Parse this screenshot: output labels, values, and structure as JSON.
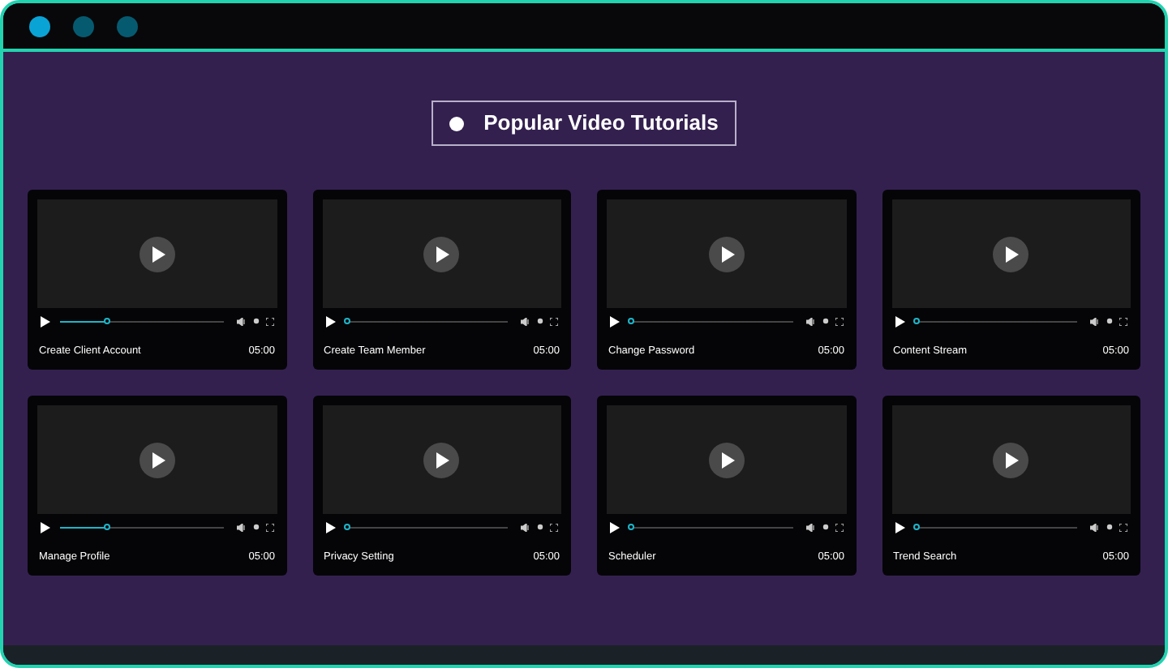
{
  "heading": "Popular Video Tutorials",
  "videos": [
    {
      "title": "Create Client Account",
      "duration": "05:00",
      "level": 0.29
    },
    {
      "title": "Create Team Member",
      "duration": "05:00",
      "level": 0.01
    },
    {
      "title": "Change Password",
      "duration": "05:00",
      "level": 0.01
    },
    {
      "title": "Content Stream",
      "duration": "05:00",
      "level": 0.01
    },
    {
      "title": "Manage Profile",
      "duration": "05:00",
      "level": 0.29
    },
    {
      "title": "Privacy Setting",
      "duration": "05:00",
      "level": 0.01
    },
    {
      "title": "Scheduler",
      "duration": "05:00",
      "level": 0.01
    },
    {
      "title": "Trend Search",
      "duration": "05:00",
      "level": 0.01
    }
  ]
}
